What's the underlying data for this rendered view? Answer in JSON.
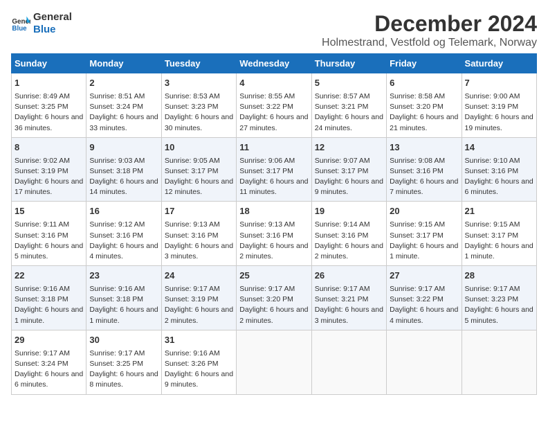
{
  "logo": {
    "line1": "General",
    "line2": "Blue"
  },
  "title": "December 2024",
  "subtitle": "Holmestrand, Vestfold og Telemark, Norway",
  "days_of_week": [
    "Sunday",
    "Monday",
    "Tuesday",
    "Wednesday",
    "Thursday",
    "Friday",
    "Saturday"
  ],
  "weeks": [
    [
      {
        "day": 1,
        "sunrise": "Sunrise: 8:49 AM",
        "sunset": "Sunset: 3:25 PM",
        "daylight": "Daylight: 6 hours and 36 minutes."
      },
      {
        "day": 2,
        "sunrise": "Sunrise: 8:51 AM",
        "sunset": "Sunset: 3:24 PM",
        "daylight": "Daylight: 6 hours and 33 minutes."
      },
      {
        "day": 3,
        "sunrise": "Sunrise: 8:53 AM",
        "sunset": "Sunset: 3:23 PM",
        "daylight": "Daylight: 6 hours and 30 minutes."
      },
      {
        "day": 4,
        "sunrise": "Sunrise: 8:55 AM",
        "sunset": "Sunset: 3:22 PM",
        "daylight": "Daylight: 6 hours and 27 minutes."
      },
      {
        "day": 5,
        "sunrise": "Sunrise: 8:57 AM",
        "sunset": "Sunset: 3:21 PM",
        "daylight": "Daylight: 6 hours and 24 minutes."
      },
      {
        "day": 6,
        "sunrise": "Sunrise: 8:58 AM",
        "sunset": "Sunset: 3:20 PM",
        "daylight": "Daylight: 6 hours and 21 minutes."
      },
      {
        "day": 7,
        "sunrise": "Sunrise: 9:00 AM",
        "sunset": "Sunset: 3:19 PM",
        "daylight": "Daylight: 6 hours and 19 minutes."
      }
    ],
    [
      {
        "day": 8,
        "sunrise": "Sunrise: 9:02 AM",
        "sunset": "Sunset: 3:19 PM",
        "daylight": "Daylight: 6 hours and 17 minutes."
      },
      {
        "day": 9,
        "sunrise": "Sunrise: 9:03 AM",
        "sunset": "Sunset: 3:18 PM",
        "daylight": "Daylight: 6 hours and 14 minutes."
      },
      {
        "day": 10,
        "sunrise": "Sunrise: 9:05 AM",
        "sunset": "Sunset: 3:17 PM",
        "daylight": "Daylight: 6 hours and 12 minutes."
      },
      {
        "day": 11,
        "sunrise": "Sunrise: 9:06 AM",
        "sunset": "Sunset: 3:17 PM",
        "daylight": "Daylight: 6 hours and 11 minutes."
      },
      {
        "day": 12,
        "sunrise": "Sunrise: 9:07 AM",
        "sunset": "Sunset: 3:17 PM",
        "daylight": "Daylight: 6 hours and 9 minutes."
      },
      {
        "day": 13,
        "sunrise": "Sunrise: 9:08 AM",
        "sunset": "Sunset: 3:16 PM",
        "daylight": "Daylight: 6 hours and 7 minutes."
      },
      {
        "day": 14,
        "sunrise": "Sunrise: 9:10 AM",
        "sunset": "Sunset: 3:16 PM",
        "daylight": "Daylight: 6 hours and 6 minutes."
      }
    ],
    [
      {
        "day": 15,
        "sunrise": "Sunrise: 9:11 AM",
        "sunset": "Sunset: 3:16 PM",
        "daylight": "Daylight: 6 hours and 5 minutes."
      },
      {
        "day": 16,
        "sunrise": "Sunrise: 9:12 AM",
        "sunset": "Sunset: 3:16 PM",
        "daylight": "Daylight: 6 hours and 4 minutes."
      },
      {
        "day": 17,
        "sunrise": "Sunrise: 9:13 AM",
        "sunset": "Sunset: 3:16 PM",
        "daylight": "Daylight: 6 hours and 3 minutes."
      },
      {
        "day": 18,
        "sunrise": "Sunrise: 9:13 AM",
        "sunset": "Sunset: 3:16 PM",
        "daylight": "Daylight: 6 hours and 2 minutes."
      },
      {
        "day": 19,
        "sunrise": "Sunrise: 9:14 AM",
        "sunset": "Sunset: 3:16 PM",
        "daylight": "Daylight: 6 hours and 2 minutes."
      },
      {
        "day": 20,
        "sunrise": "Sunrise: 9:15 AM",
        "sunset": "Sunset: 3:17 PM",
        "daylight": "Daylight: 6 hours and 1 minute."
      },
      {
        "day": 21,
        "sunrise": "Sunrise: 9:15 AM",
        "sunset": "Sunset: 3:17 PM",
        "daylight": "Daylight: 6 hours and 1 minute."
      }
    ],
    [
      {
        "day": 22,
        "sunrise": "Sunrise: 9:16 AM",
        "sunset": "Sunset: 3:18 PM",
        "daylight": "Daylight: 6 hours and 1 minute."
      },
      {
        "day": 23,
        "sunrise": "Sunrise: 9:16 AM",
        "sunset": "Sunset: 3:18 PM",
        "daylight": "Daylight: 6 hours and 1 minute."
      },
      {
        "day": 24,
        "sunrise": "Sunrise: 9:17 AM",
        "sunset": "Sunset: 3:19 PM",
        "daylight": "Daylight: 6 hours and 2 minutes."
      },
      {
        "day": 25,
        "sunrise": "Sunrise: 9:17 AM",
        "sunset": "Sunset: 3:20 PM",
        "daylight": "Daylight: 6 hours and 2 minutes."
      },
      {
        "day": 26,
        "sunrise": "Sunrise: 9:17 AM",
        "sunset": "Sunset: 3:21 PM",
        "daylight": "Daylight: 6 hours and 3 minutes."
      },
      {
        "day": 27,
        "sunrise": "Sunrise: 9:17 AM",
        "sunset": "Sunset: 3:22 PM",
        "daylight": "Daylight: 6 hours and 4 minutes."
      },
      {
        "day": 28,
        "sunrise": "Sunrise: 9:17 AM",
        "sunset": "Sunset: 3:23 PM",
        "daylight": "Daylight: 6 hours and 5 minutes."
      }
    ],
    [
      {
        "day": 29,
        "sunrise": "Sunrise: 9:17 AM",
        "sunset": "Sunset: 3:24 PM",
        "daylight": "Daylight: 6 hours and 6 minutes."
      },
      {
        "day": 30,
        "sunrise": "Sunrise: 9:17 AM",
        "sunset": "Sunset: 3:25 PM",
        "daylight": "Daylight: 6 hours and 8 minutes."
      },
      {
        "day": 31,
        "sunrise": "Sunrise: 9:16 AM",
        "sunset": "Sunset: 3:26 PM",
        "daylight": "Daylight: 6 hours and 9 minutes."
      },
      null,
      null,
      null,
      null
    ]
  ]
}
